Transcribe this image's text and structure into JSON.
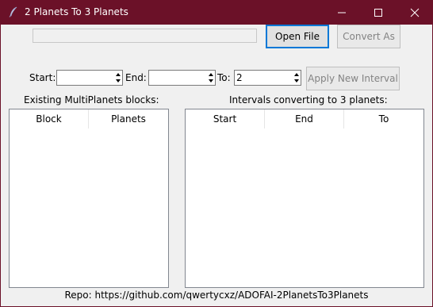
{
  "window": {
    "title": "2 Planets To 3 Planets",
    "icon": "feather-icon",
    "controls": [
      "minimize-icon",
      "maximize-icon",
      "close-icon"
    ]
  },
  "file_row": {
    "path_value": "",
    "open_label": "Open File",
    "convert_label": "Convert As"
  },
  "interval_row": {
    "start_label": "Start:",
    "start_value": "",
    "end_label": "End:",
    "end_value": "",
    "to_label": "To:",
    "to_value": "2",
    "apply_label": "Apply New Interval"
  },
  "blocks_panel": {
    "title": "Existing MultiPlanets blocks:",
    "columns": [
      "Block",
      "Planets"
    ],
    "rows": []
  },
  "intervals_panel": {
    "title": "Intervals converting to 3 planets:",
    "columns": [
      "Start",
      "End",
      "To"
    ],
    "rows": []
  },
  "footer": {
    "repo_text": "Repo: https://github.com/qwertycxz/ADOFAI-2PlanetsTo3Planets"
  },
  "colors": {
    "titlebar": "#6b1128",
    "client_bg": "#f0f0f0",
    "focus_border": "#0078d7",
    "disabled_text": "#838383"
  }
}
